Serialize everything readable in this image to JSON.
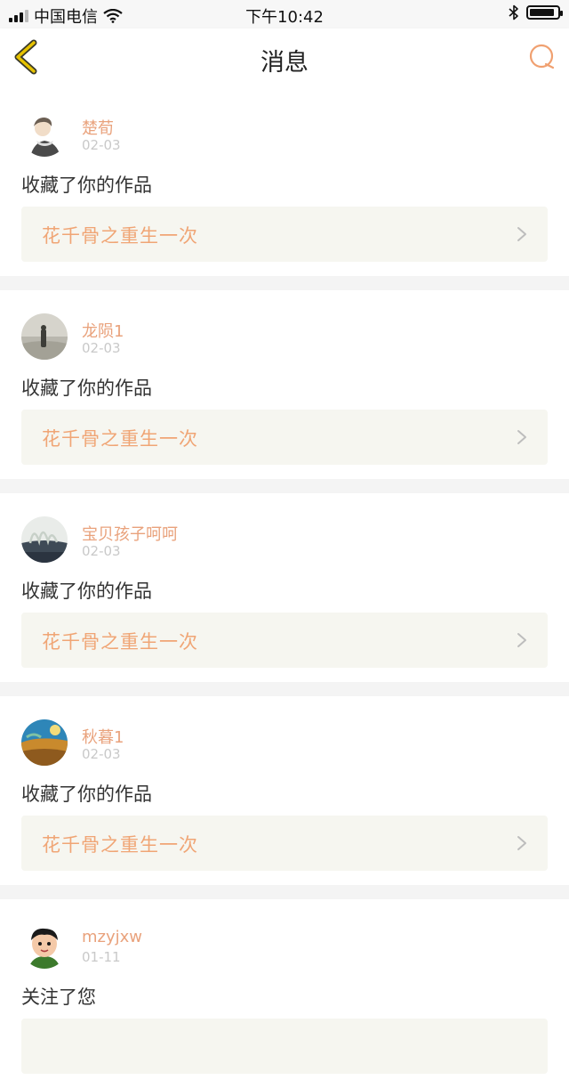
{
  "status_bar": {
    "carrier": "中国电信",
    "time": "下午10:42",
    "bluetooth_icon": "bluetooth-icon",
    "wifi_icon": "wifi-icon",
    "battery_level": 0.92
  },
  "nav": {
    "title": "消息",
    "back_icon": "chevron-left-icon",
    "search_icon": "search-icon",
    "accent": "#f0a070",
    "back_color": "#d9b400"
  },
  "messages": [
    {
      "user": "楚荀",
      "date": "02-03",
      "action": "收藏了你的作品",
      "work": "花千骨之重生一次"
    },
    {
      "user": "龙陨1",
      "date": "02-03",
      "action": "收藏了你的作品",
      "work": "花千骨之重生一次"
    },
    {
      "user": "宝贝孩子呵呵",
      "date": "02-03",
      "action": "收藏了你的作品",
      "work": "花千骨之重生一次"
    },
    {
      "user": "秋暮1",
      "date": "02-03",
      "action": "收藏了你的作品",
      "work": "花千骨之重生一次"
    },
    {
      "user": "mzyjxw",
      "date": "01-11",
      "action": "关注了您",
      "work": ""
    }
  ]
}
